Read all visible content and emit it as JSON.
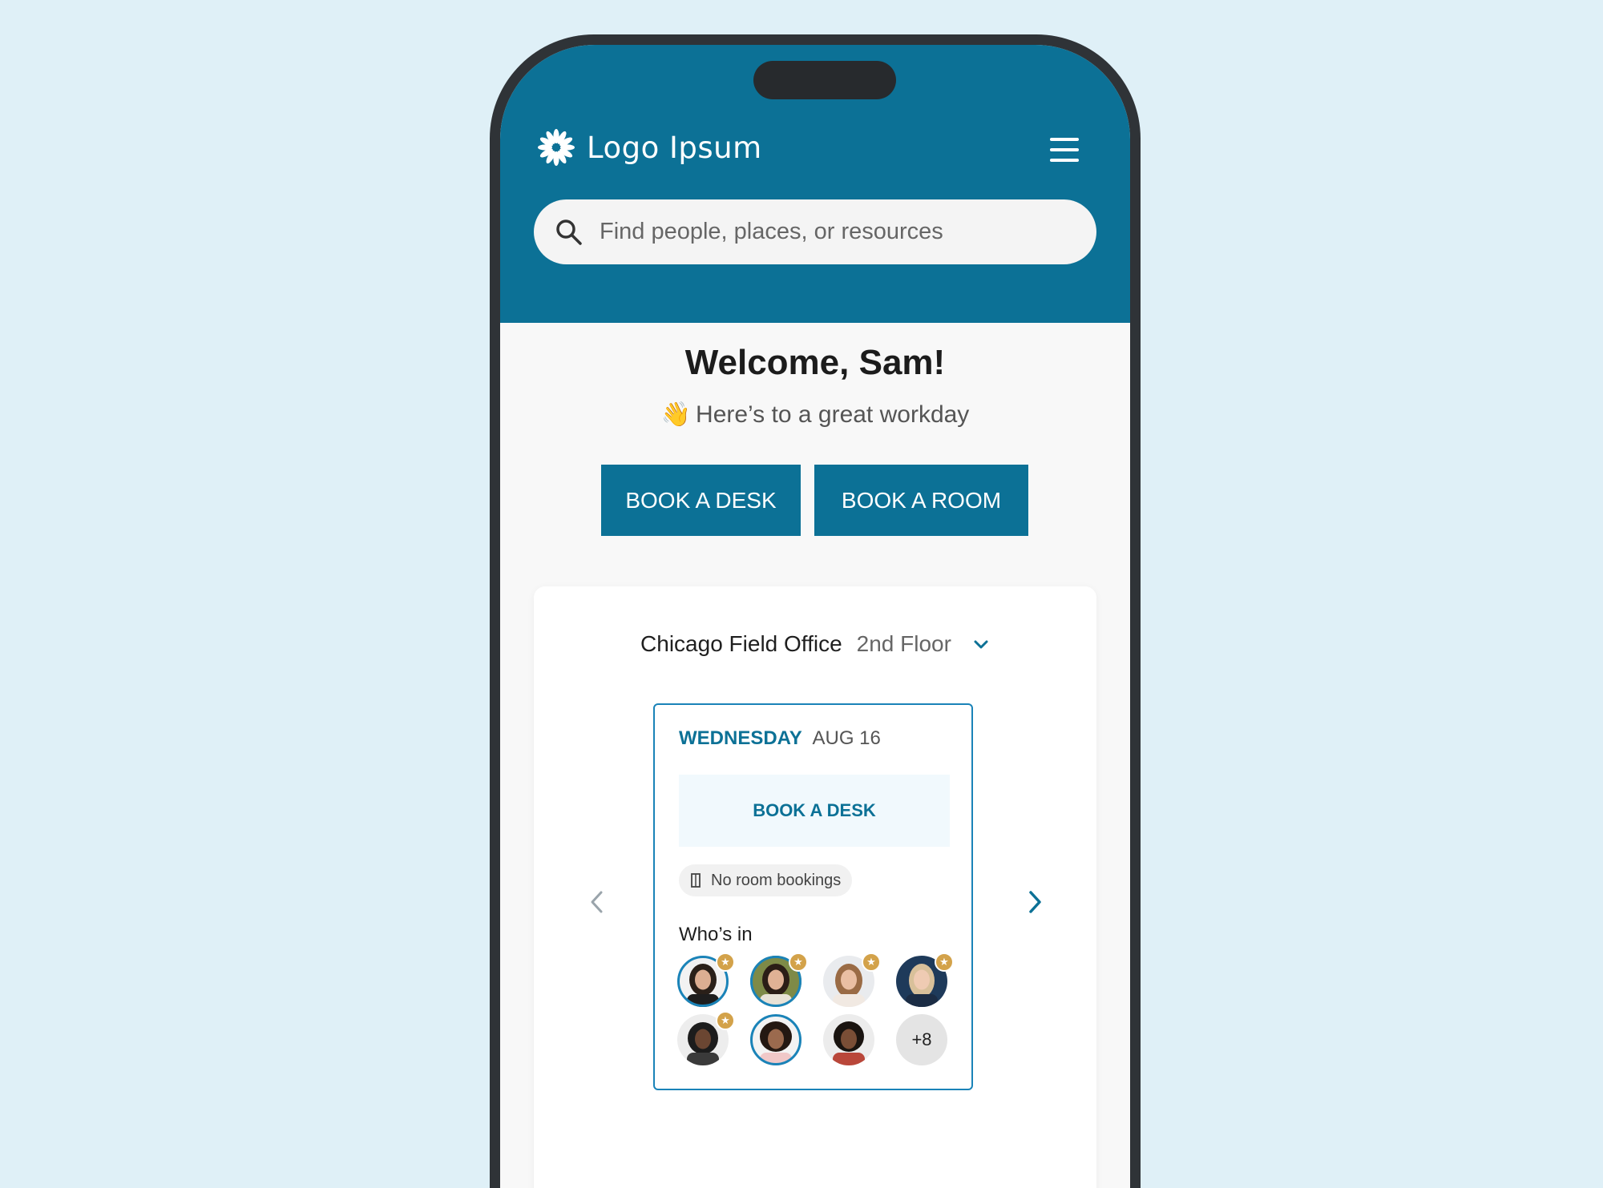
{
  "header": {
    "brand_name": "Logo Ipsum",
    "logo_icon": "sunburst-logo-icon",
    "menu_icon": "hamburger-menu-icon",
    "search_placeholder": "Find people, places, or resources",
    "search_icon": "magnifier-icon"
  },
  "welcome": {
    "title": "Welcome, Sam!",
    "emoji": "👋",
    "subtitle": "Here’s to a great workday"
  },
  "actions": {
    "book_desk": "BOOK A DESK",
    "book_room": "BOOK A ROOM"
  },
  "location": {
    "office": "Chicago Field Office",
    "floor": "2nd Floor"
  },
  "day_card": {
    "day": "WEDNESDAY",
    "date": "AUG 16",
    "book_desk": "BOOK A DESK",
    "room_status": "No room bookings",
    "whos_in_label": "Who’s in",
    "more_count": "+8",
    "avatars": [
      {
        "ring": true,
        "star": true
      },
      {
        "ring": true,
        "star": true
      },
      {
        "ring": false,
        "star": true
      },
      {
        "ring": false,
        "star": true
      },
      {
        "ring": false,
        "star": true
      },
      {
        "ring": true,
        "star": false
      },
      {
        "ring": false,
        "star": false
      }
    ]
  },
  "colors": {
    "brand": "#0c7196",
    "background": "#dff0f7",
    "accent_ring": "#1a83b8",
    "favorite_star": "#d3a24a"
  }
}
